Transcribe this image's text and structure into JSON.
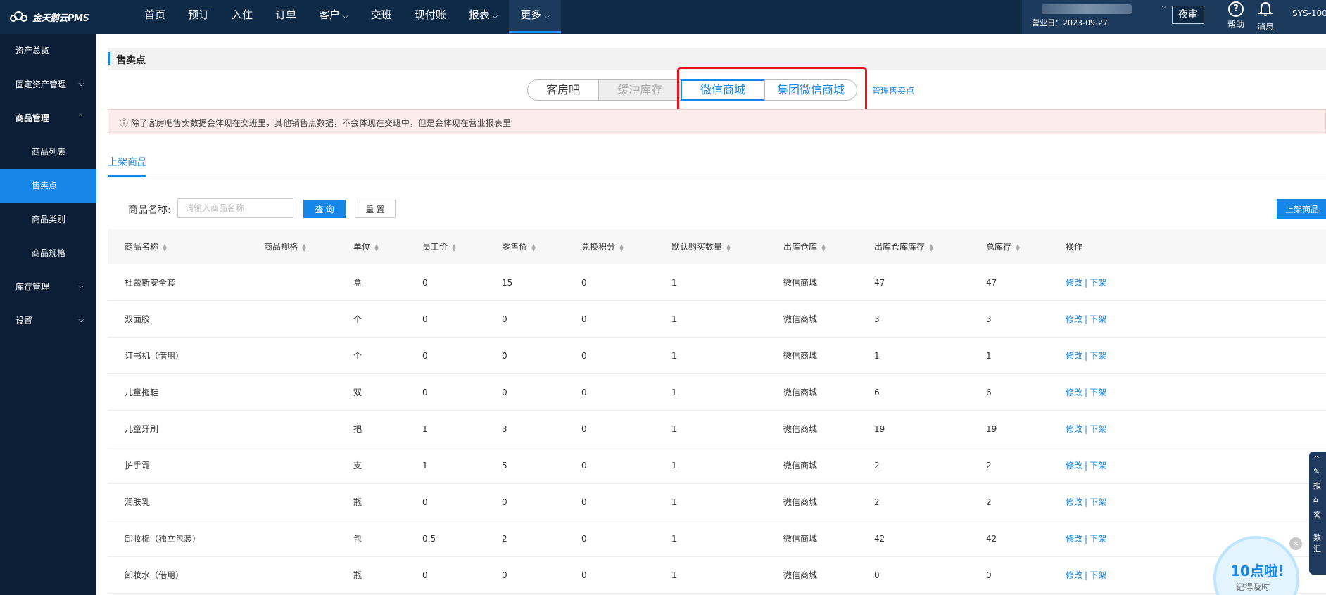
{
  "app": {
    "logo_text": "金天鹅云PMS"
  },
  "nav": {
    "items": [
      {
        "label": "首页",
        "chevron": false
      },
      {
        "label": "预订",
        "chevron": false
      },
      {
        "label": "入住",
        "chevron": false
      },
      {
        "label": "订单",
        "chevron": false
      },
      {
        "label": "客户",
        "chevron": true
      },
      {
        "label": "交班",
        "chevron": false
      },
      {
        "label": "现付账",
        "chevron": false
      },
      {
        "label": "报表",
        "chevron": true
      },
      {
        "label": "更多",
        "chevron": true,
        "active": true
      }
    ],
    "chevron": "⌵"
  },
  "header_right": {
    "business_date": "营业日：2023-09-27",
    "night_audit": "夜审",
    "help": "帮助",
    "messages": "消息",
    "system_id": "SYS-100"
  },
  "sidebar": {
    "items": [
      {
        "label": "资产总览",
        "level": 1,
        "arrow": ""
      },
      {
        "label": "固定资产管理",
        "level": 1,
        "arrow": "⌵"
      },
      {
        "label": "商品管理",
        "level": 1,
        "arrow": "⌃",
        "bold": true
      },
      {
        "label": "商品列表",
        "level": 2,
        "arrow": ""
      },
      {
        "label": "售卖点",
        "level": 2,
        "arrow": "",
        "active": true
      },
      {
        "label": "商品类别",
        "level": 2,
        "arrow": ""
      },
      {
        "label": "商品规格",
        "level": 2,
        "arrow": ""
      },
      {
        "label": "库存管理",
        "level": 1,
        "arrow": "⌵"
      },
      {
        "label": "设置",
        "level": 1,
        "arrow": "⌵"
      }
    ]
  },
  "page": {
    "title": "售卖点",
    "segments": [
      "客房吧",
      "缓冲库存",
      "微信商城",
      "集团微信商城"
    ],
    "manage_link": "管理售卖点",
    "notice": "ⓘ 除了客房吧售卖数据会体现在交班里，其他销售点数据，不会体现在交班中，但是会体现在营业报表里",
    "subtab": "上架商品",
    "search": {
      "label": "商品名称:",
      "placeholder": "请输入商品名称",
      "query": "查 询",
      "reset": "重 置",
      "shelve": "上架商品"
    }
  },
  "table": {
    "headers": [
      "商品名称",
      "商品规格",
      "单位",
      "员工价",
      "零售价",
      "兑换积分",
      "默认购买数量",
      "出库仓库",
      "出库仓库库存",
      "总库存",
      "操作"
    ],
    "sortable": [
      true,
      true,
      true,
      true,
      true,
      true,
      true,
      true,
      true,
      true,
      false
    ],
    "rows": [
      [
        "杜蕾斯安全套",
        "",
        "盒",
        "0",
        "15",
        "0",
        "1",
        "微信商城",
        "47",
        "47"
      ],
      [
        "双面胶",
        "",
        "个",
        "0",
        "0",
        "0",
        "1",
        "微信商城",
        "3",
        "3"
      ],
      [
        "订书机（借用）",
        "",
        "个",
        "0",
        "0",
        "0",
        "1",
        "微信商城",
        "1",
        "1"
      ],
      [
        "儿童拖鞋",
        "",
        "双",
        "0",
        "0",
        "0",
        "1",
        "微信商城",
        "6",
        "6"
      ],
      [
        "儿童牙刷",
        "",
        "把",
        "1",
        "3",
        "0",
        "1",
        "微信商城",
        "19",
        "19"
      ],
      [
        "护手霜",
        "",
        "支",
        "1",
        "5",
        "0",
        "1",
        "微信商城",
        "2",
        "2"
      ],
      [
        "润肤乳",
        "",
        "瓶",
        "0",
        "0",
        "0",
        "1",
        "微信商城",
        "2",
        "2"
      ],
      [
        "卸妆棉（独立包装）",
        "",
        "包",
        "0.5",
        "2",
        "0",
        "1",
        "微信商城",
        "42",
        "42"
      ],
      [
        "卸妆水（借用）",
        "",
        "瓶",
        "0",
        "0",
        "0",
        "1",
        "微信商城",
        "0",
        "0"
      ]
    ],
    "op_edit": "修改",
    "op_sep": "|",
    "op_off": "下架"
  },
  "float_panel": {
    "labels": [
      "报",
      "客",
      "数",
      "汇"
    ]
  },
  "reminder": {
    "title": "10点啦!",
    "subtitle": "记得及时",
    "close": "×"
  },
  "colors": {
    "accent": "#1786e9",
    "nav_bg": "#0f2a46",
    "sidebar_bg": "#0b1e36",
    "highlight_box": "#e8141c"
  }
}
